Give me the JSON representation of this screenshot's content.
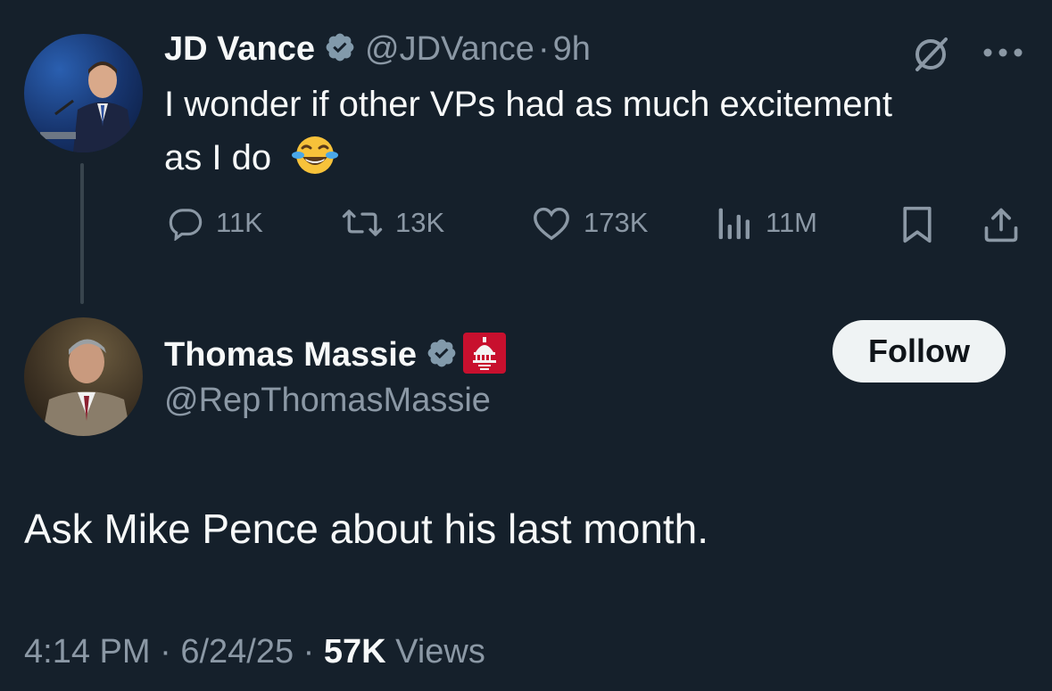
{
  "original_tweet": {
    "author_name": "JD Vance",
    "handle": "@JDVance",
    "separator": "·",
    "time_ago": "9h",
    "text_line1": "I wonder if other VPs had as much excitement",
    "text_line2": "as I do",
    "emoji_icon": "face-with-tears-of-joy-icon",
    "actions": {
      "replies": "11K",
      "retweets": "13K",
      "likes": "173K",
      "views": "11M"
    }
  },
  "reply_tweet": {
    "author_name": "Thomas Massie",
    "handle": "@RepThomasMassie",
    "follow_label": "Follow",
    "text": "Ask Mike Pence about his last month.",
    "time": "4:14 PM",
    "date": "6/24/25",
    "views_count": "57K",
    "views_label": "Views",
    "separator": "·"
  },
  "colors": {
    "background": "#15202b",
    "text": "#f7f9f9",
    "muted": "#8b98a5",
    "verified": "#829aab",
    "affiliate_badge": "#c8102e",
    "follow_bg": "#eff3f4"
  }
}
